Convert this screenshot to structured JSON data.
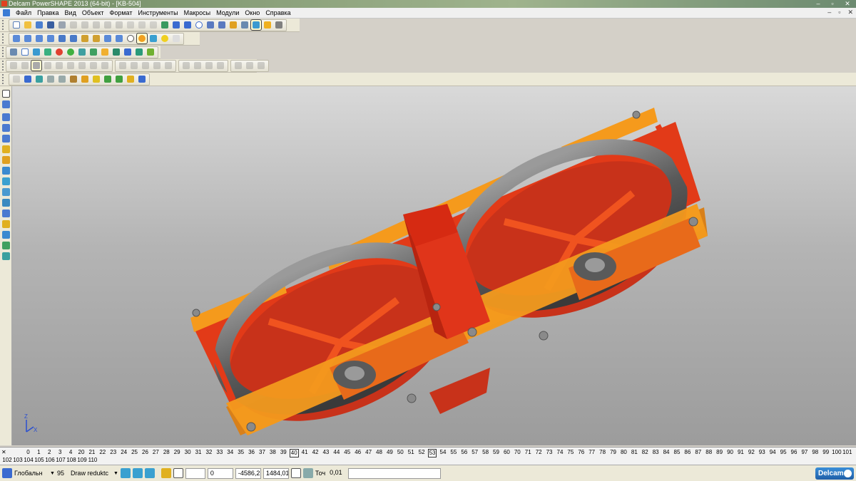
{
  "window": {
    "title": "Delcam PowerSHAPE 2013 (64-bit) - [KB-504]"
  },
  "menu": [
    "Файл",
    "Правка",
    "Вид",
    "Объект",
    "Формат",
    "Инструменты",
    "Макросы",
    "Модули",
    "Окно",
    "Справка"
  ],
  "window_controls": {
    "minimize": "–",
    "restore": "▫",
    "close": "✕"
  },
  "mdi_controls": {
    "minimize": "–",
    "restore": "▫",
    "close": "✕"
  },
  "levels": {
    "close": "✕",
    "row1": [
      "0",
      "1",
      "2",
      "3",
      "4",
      "20",
      "21",
      "22",
      "23",
      "24",
      "25",
      "26",
      "27",
      "28",
      "29",
      "30",
      "31",
      "32",
      "33",
      "34",
      "35",
      "36",
      "37",
      "38",
      "39",
      "40",
      "41",
      "42",
      "43",
      "44",
      "45",
      "46",
      "47",
      "48",
      "49",
      "50",
      "51",
      "52",
      "53",
      "54",
      "55",
      "56",
      "57",
      "58",
      "59",
      "60",
      "70",
      "71",
      "72",
      "73",
      "74",
      "75",
      "76",
      "77",
      "78",
      "79",
      "80",
      "81",
      "82",
      "83",
      "84",
      "85",
      "86",
      "87",
      "88",
      "89",
      "90",
      "91",
      "92",
      "93",
      "94",
      "95",
      "96",
      "97",
      "98",
      "99",
      "100",
      "101"
    ],
    "row2": [
      "102",
      "103",
      "104",
      "105",
      "106",
      "107",
      "108",
      "109",
      "110"
    ],
    "boxed": [
      "40",
      "53"
    ]
  },
  "status": {
    "workplane": "Глобальн",
    "level_number": "95",
    "level_name": "Draw reduktc",
    "grid_value": "",
    "x": "0",
    "y": "-4586,2",
    "z": "1484,01",
    "tolerance_label": "Точ",
    "tolerance": "0,01",
    "message": ""
  },
  "brand": "Delcam",
  "axis_triad": {
    "z": "Z",
    "x": "X"
  },
  "colors": {
    "frame_orange": "#f59a1c",
    "frame_red": "#e8341a",
    "wheel_grey": "#6a6a6a",
    "bolt_grey": "#8a8a8a"
  }
}
